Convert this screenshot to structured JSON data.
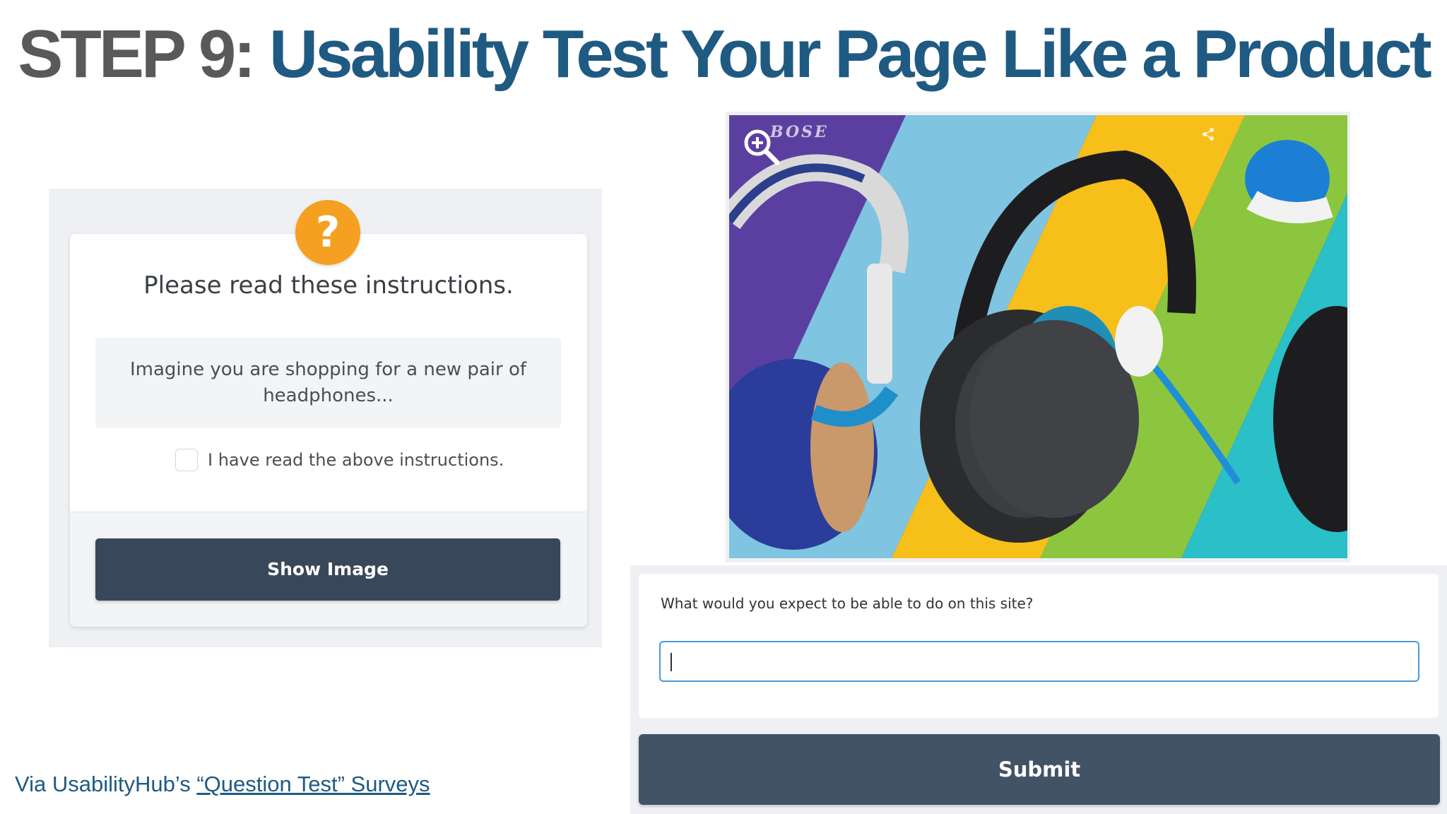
{
  "slide": {
    "title_prefix": "STEP 9:",
    "title_main": "Usability Test Your Page Like a Product",
    "colors": {
      "title_prefix": "#595959",
      "title_main": "#1f5a82"
    }
  },
  "instructions_card": {
    "badge_symbol": "?",
    "badge_color": "#f5a020",
    "heading": "Please read these instructions.",
    "instruction_text": "Imagine you are shopping for a new pair of headphones...",
    "checkbox_label": "I have read the above instructions.",
    "checkbox_checked": false,
    "button_label": "Show Image",
    "button_color": "#38485a"
  },
  "preview_image": {
    "icon": "zoom-in-icon",
    "brand": "BOSE",
    "nav_icon": "share-icon",
    "stripe_colors": [
      "#5b3fa0",
      "#7fc4e0",
      "#f6bf1a",
      "#8cc63f",
      "#2bbfc7"
    ]
  },
  "question_card": {
    "question": "What would you expect to be able to do on this site?",
    "answer_value": "",
    "submit_label": "Submit",
    "input_border_color": "#4a9bd8",
    "submit_color": "#425366"
  },
  "footer": {
    "prefix": "Via UsabilityHub’s ",
    "link_text": "“Question Test” Surveys"
  }
}
